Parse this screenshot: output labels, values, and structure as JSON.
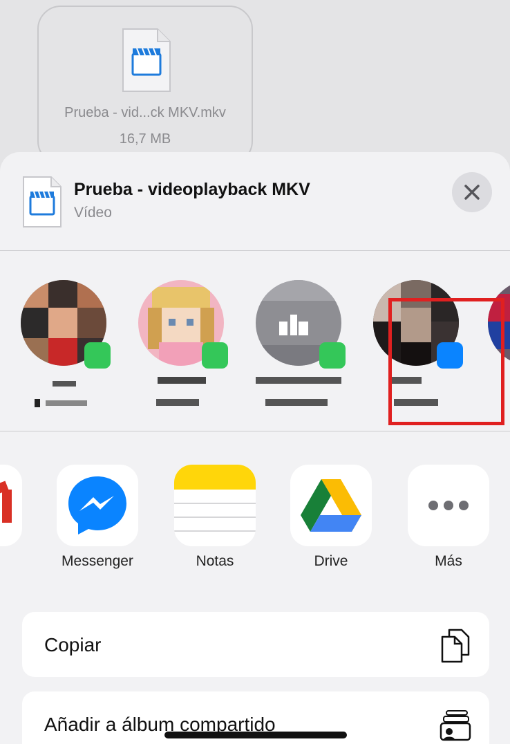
{
  "file_card": {
    "name": "Prueba - vid...ck MKV.mkv",
    "size": "16,7 MB"
  },
  "header": {
    "title": "Prueba - videoplayback MKV",
    "subtitle": "Vídeo"
  },
  "contacts": [
    {
      "badge_color": "#34c759",
      "avatar_colors": [
        "#6b4a3a",
        "#c88a6a",
        "#2c2a2a",
        "#9a7052"
      ]
    },
    {
      "badge_color": "#34c759",
      "avatar_colors": [
        "#f2b5c2",
        "#e8c46a",
        "#f4d9c2",
        "#b88a4a"
      ]
    },
    {
      "badge_color": "#34c759",
      "avatar_colors": [
        "#8e8e93",
        "#a5a5aa",
        "#7a7a80",
        "#ffffff"
      ]
    },
    {
      "badge_color": "#0a84ff",
      "avatar_colors": [
        "#2a2626",
        "#7a6a62",
        "#4a3e3a",
        "#c9b8ae"
      ]
    }
  ],
  "apps": [
    {
      "label": "Messenger",
      "icon": "messenger-icon"
    },
    {
      "label": "Notas",
      "icon": "notes-icon"
    },
    {
      "label": "Drive",
      "icon": "google-drive-icon"
    },
    {
      "label": "Más",
      "icon": "more-icon"
    }
  ],
  "actions": [
    {
      "label": "Copiar",
      "icon": "copy-icon"
    },
    {
      "label": "Añadir a álbum compartido",
      "icon": "shared-album-icon"
    }
  ],
  "colors": {
    "highlight": "#e02020",
    "messenger_blue": "#0a84ff",
    "notes_yellow": "#ffd60a"
  }
}
